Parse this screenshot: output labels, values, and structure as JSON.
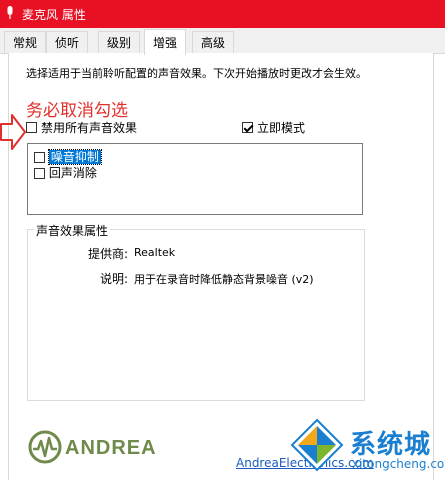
{
  "window": {
    "title": "麦克风 属性"
  },
  "tabs": [
    {
      "label": "常规",
      "active": false
    },
    {
      "label": "侦听",
      "active": false
    },
    {
      "label": "级别",
      "active": false
    },
    {
      "label": "增强",
      "active": true
    },
    {
      "label": "高级",
      "active": false
    }
  ],
  "enhancements": {
    "description": "选择适用于当前聆听配置的声音效果。下次开始播放时更改才会生效。",
    "annotation": "务必取消勾选",
    "disable_all_label": "禁用所有声音效果",
    "disable_all_checked": false,
    "immediate_mode_label": "立即模式",
    "immediate_mode_checked": true,
    "items": [
      {
        "label": "噪音抑制",
        "checked": false,
        "selected": true
      },
      {
        "label": "回声消除",
        "checked": false,
        "selected": false
      }
    ]
  },
  "properties": {
    "group_title": "声音效果属性",
    "provider_label": "提供商:",
    "provider_value": "Realtek",
    "description_label": "说明:",
    "description_value": "用于在录音时降低静态背景噪音 (v2)"
  },
  "footer": {
    "logo_text": "ANDREA",
    "link_text": "AndreaElectronics.com"
  },
  "watermark": {
    "brand": "系统城",
    "domain": "xitongcheng.com"
  },
  "colors": {
    "titlebar": "#e81123",
    "annotation": "#e0302b",
    "selection": "#0078d7",
    "link": "#1a5cbf",
    "watermark": "#1a7fd1"
  }
}
